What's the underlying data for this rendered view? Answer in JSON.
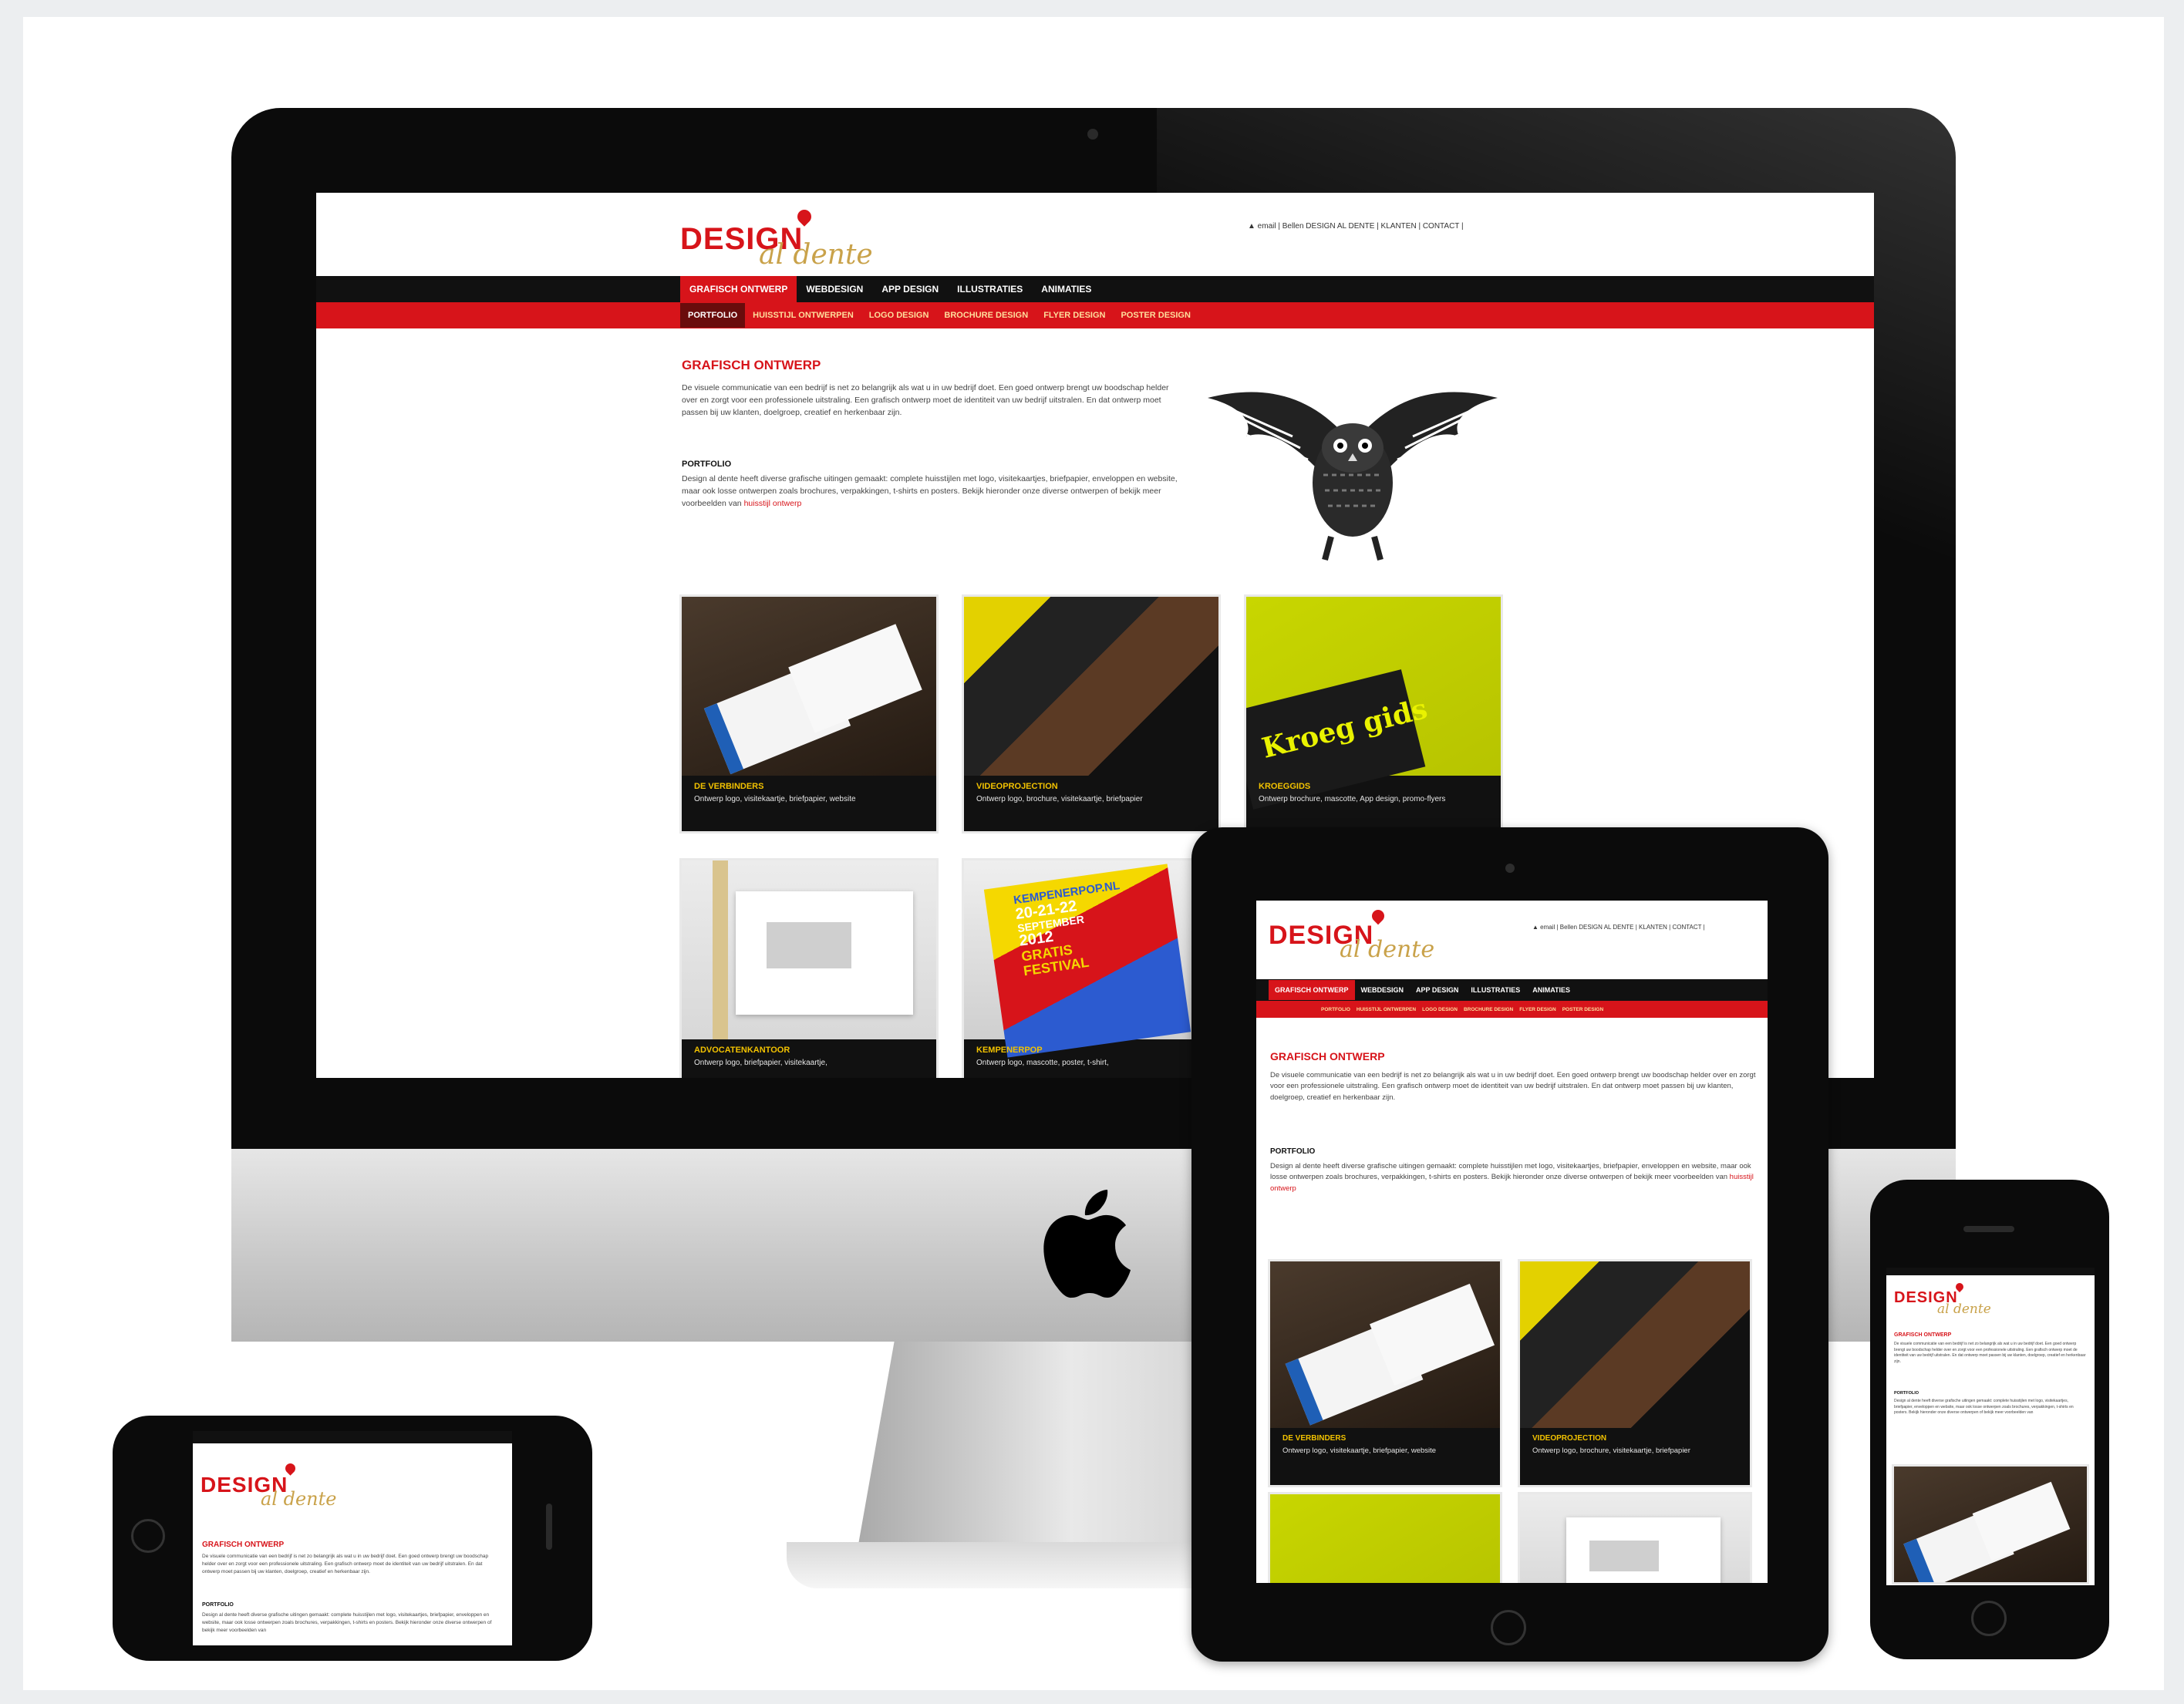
{
  "colors": {
    "brand_red": "#d7141a",
    "brand_gold": "#c9a24a",
    "nav_black": "#111111",
    "caption_yellow": "#f2c200"
  },
  "site": {
    "logo_main": "DESIGN",
    "logo_sub": "al dente",
    "topbar": "▲ email | Bellen DESIGN AL DENTE | KLANTEN | CONTACT |",
    "nav": [
      "GRAFISCH ONTWERP",
      "WEBDESIGN",
      "APP DESIGN",
      "ILLUSTRATIES",
      "ANIMATIES"
    ],
    "subnav": [
      "PORTFOLIO",
      "HUISSTIJL ONTWERPEN",
      "LOGO DESIGN",
      "BROCHURE DESIGN",
      "FLYER DESIGN",
      "POSTER DESIGN"
    ],
    "heading": "GRAFISCH ONTWERP",
    "intro": "De visuele communicatie van een bedrijf is net zo belangrijk als wat u in uw bedrijf doet. Een goed ontwerp brengt uw boodschap helder over en zorgt voor een professionele uitstraling. Een grafisch ontwerp moet de identiteit van uw bedrijf uitstralen. En dat ontwerp moet passen bij uw klanten, doelgroep, creatief en herkenbaar zijn.",
    "portfolio_heading": "PORTFOLIO",
    "portfolio_text": "Design al dente heeft diverse grafische uitingen gemaakt: complete huisstijlen met logo, visitekaartjes, briefpapier, enveloppen en website, maar ook losse ontwerpen zoals brochures, verpakkingen, t-shirts en posters. Bekijk hieronder onze diverse ontwerpen of bekijk meer voorbeelden van",
    "portfolio_link": "huisstijl ontwerp",
    "tiles": [
      {
        "title": "DE VERBINDERS",
        "desc": "Ontwerp logo, visitekaartje, briefpapier, website"
      },
      {
        "title": "VIDEOPROJECTION",
        "desc": "Ontwerp logo, brochure, visitekaartje, briefpapier"
      },
      {
        "title": "KROEGGIDS",
        "desc": "Ontwerp brochure, mascotte, App design, promo-flyers"
      },
      {
        "title": "ADVOCATENKANTOOR",
        "desc": "Ontwerp logo, briefpapier, visitekaartje,"
      },
      {
        "title": "KEMPENERPOP",
        "desc": "Ontwerp logo, mascotte, poster, t-shirt,"
      }
    ],
    "poster_text": [
      "KEMPENERPOP.NL",
      "20-21-22",
      "SEPTEMBER",
      "2012",
      "GRATIS",
      "FESTIVAL"
    ],
    "kroeg_text": "Kroeg gids"
  },
  "icons": {
    "owl": "owl-illustration",
    "apple": "apple-logo-icon"
  }
}
